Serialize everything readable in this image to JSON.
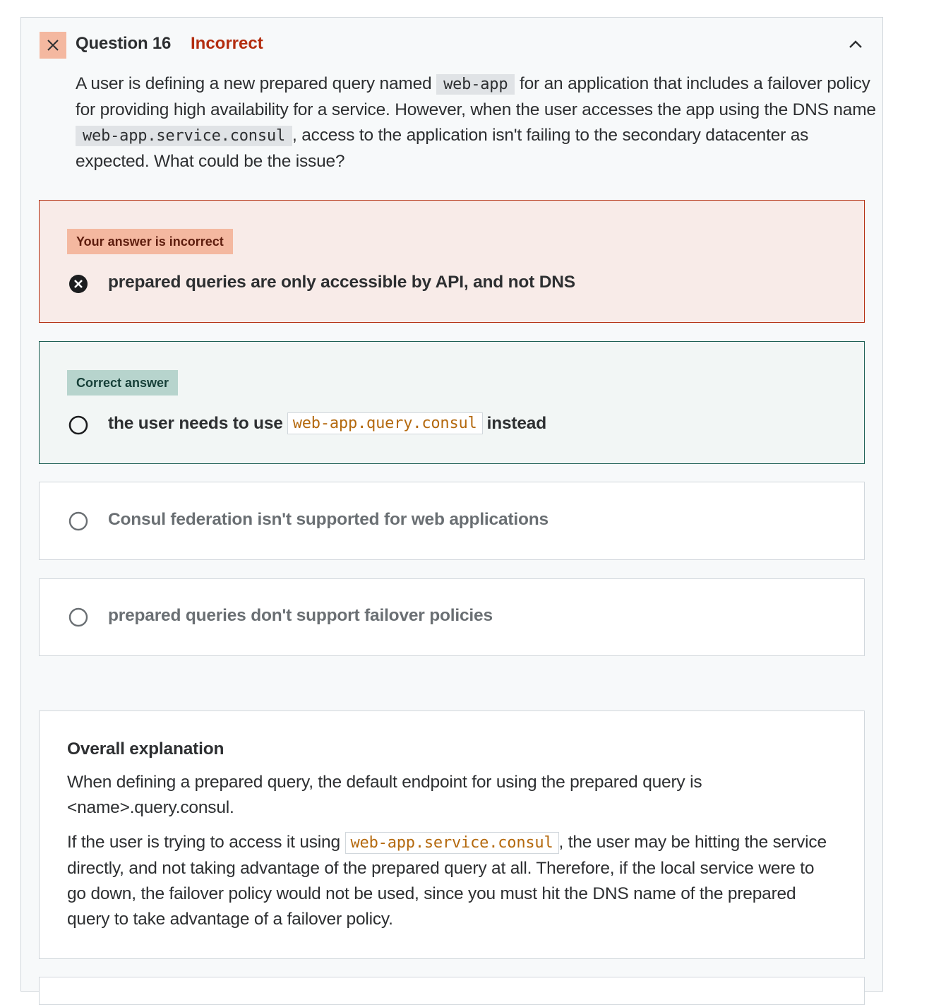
{
  "question": {
    "title": "Question 16",
    "status": "Incorrect",
    "text_before_code1": "A user is defining a new prepared query named ",
    "code1": "web-app",
    "text_after_code1": " for an application that includes a failover policy for providing high availability for a service. However, when the user accesses the app using the DNS name ",
    "code2": "web-app.service.consul",
    "text_after_code2": ", access to the application isn't failing to the secondary datacenter as expected. What could be the issue?"
  },
  "your_answer": {
    "tag": "Your answer is incorrect",
    "text": "prepared queries are only accessible by API, and not DNS"
  },
  "correct_answer": {
    "tag": "Correct answer",
    "text_before": "the user needs to use",
    "code": "web-app.query.consul",
    "text_after": "instead"
  },
  "other_options": [
    "Consul federation isn't supported for web applications",
    "prepared queries don't support failover policies"
  ],
  "explanation": {
    "heading": "Overall explanation",
    "p1": "When defining a prepared query, the default endpoint for using the prepared query is <name>.query.consul.",
    "p2_before": "If the user is trying to access it using ",
    "p2_code": "web-app.service.consul",
    "p2_after": ", the user may be hitting the service directly, and not taking advantage of the prepared query at all. Therefore, if the local service were to go down, the failover policy would not be used, since you must hit the DNS name of the prepared query to take advantage of a failover policy."
  },
  "colors": {
    "incorrect": "#b32d0f",
    "incorrect_bg": "#f8ebe8",
    "correct": "#1e6055",
    "correct_bg": "#f2f6f5",
    "code_accent": "#b4690e"
  },
  "icons": {
    "status": "close-icon",
    "collapse": "chevron-up-icon",
    "wrong_choice": "x-circle-icon",
    "option": "radio-empty-icon"
  }
}
